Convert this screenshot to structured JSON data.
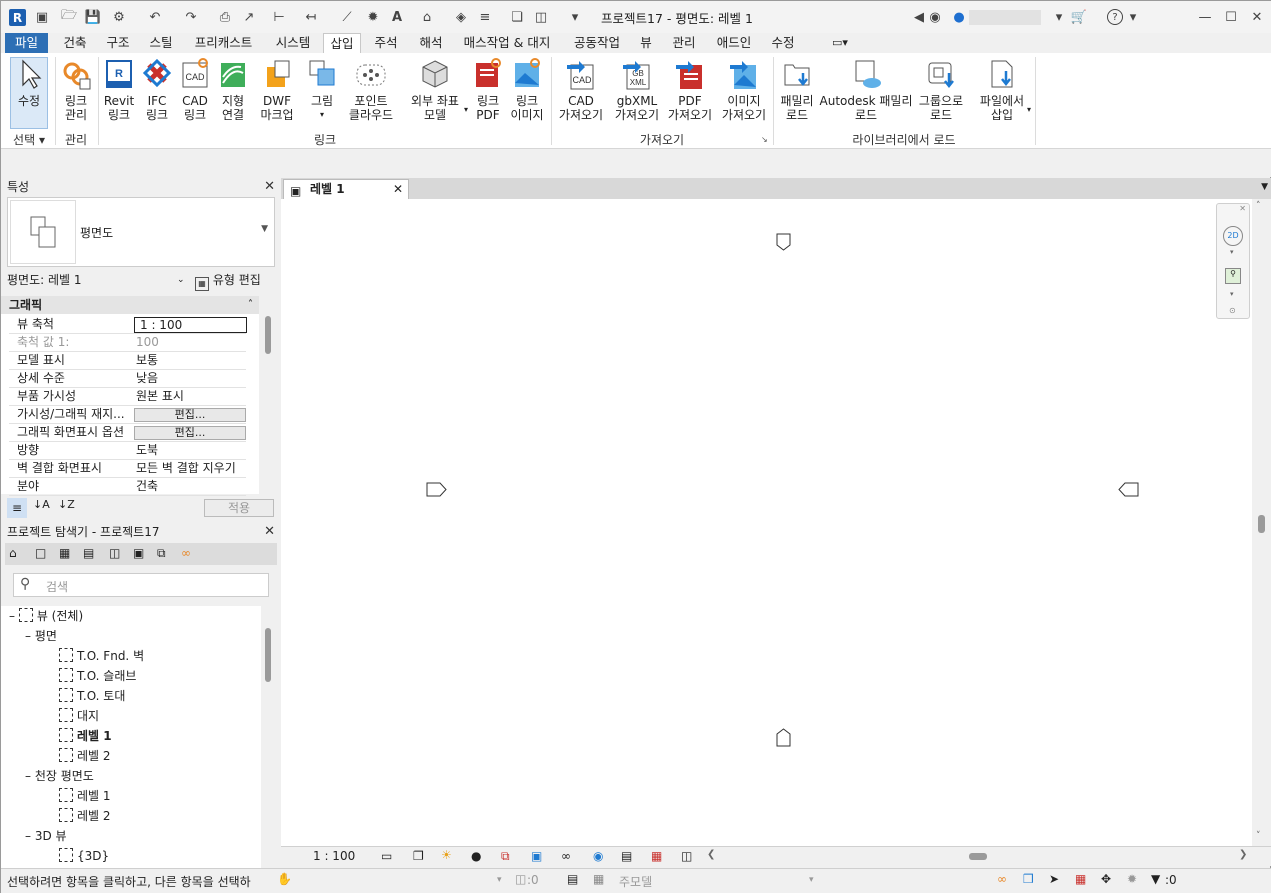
{
  "app": {
    "window_title": "프로젝트17 - 평면도: 레벨 1",
    "logo_letter": "R"
  },
  "colors": {
    "file_tab": "#2d6fb5",
    "accent_blue": "#1e7ad1",
    "accent_orange": "#e8892a",
    "accent_red": "#c9302c"
  },
  "menu": {
    "tabs": [
      "파일",
      "건축",
      "구조",
      "스틸",
      "프리캐스트",
      "시스템",
      "삽입",
      "주석",
      "해석",
      "매스작업 & 대지",
      "공동작업",
      "뷰",
      "관리",
      "애드인",
      "수정"
    ],
    "active_tab": "삽입"
  },
  "ribbon": {
    "modify": "수정",
    "select_group": "선택",
    "link_manage": "링크\n관리",
    "manage_group": "관리",
    "revit_link": "Revit\n링크",
    "ifc_link": "IFC\n링크",
    "cad_link": "CAD\n링크",
    "terrain_link": "지형\n연결",
    "dwf_markup": "DWF\n마크업",
    "image": "그림",
    "point_cloud": "포인트\n클라우드",
    "coord_model": "외부 좌표\n모델",
    "link_pdf": "링크\nPDF",
    "link_image": "링크\n이미지",
    "link_group": "링크",
    "cad_import": "CAD\n가져오기",
    "gbxml_import": "gbXML\n가져오기",
    "pdf_import": "PDF\n가져오기",
    "image_import": "이미지\n가져오기",
    "import_group": "가져오기",
    "family_load": "패밀리\n로드",
    "autodesk_family": "Autodesk 패밀리\n로드",
    "group_load": "그룹으로\n로드",
    "insert_from_file": "파일에서\n삽입",
    "library_group": "라이브러리에서 로드"
  },
  "properties": {
    "title": "특성",
    "type_name": "평면도",
    "instance_selector": "평면도: 레벨 1",
    "edit_type": "유형 편집",
    "section": "그래픽",
    "rows": [
      {
        "k": "뷰 축척",
        "v": "1 : 100"
      },
      {
        "k": "축척 값    1:",
        "v": "100"
      },
      {
        "k": "모델 표시",
        "v": "보통"
      },
      {
        "k": "상세 수준",
        "v": "낮음"
      },
      {
        "k": "부품 가시성",
        "v": "원본 표시"
      },
      {
        "k": "가시성/그래픽 재지...",
        "v": "편집..."
      },
      {
        "k": "그래픽 화면표시 옵션",
        "v": "편집..."
      },
      {
        "k": "방향",
        "v": "도북"
      },
      {
        "k": "벽 결합 화면표시",
        "v": "모든 벽 결합 지우기"
      },
      {
        "k": "분야",
        "v": "건축"
      }
    ],
    "apply": "적용"
  },
  "browser": {
    "title": "프로젝트 탐색기 - 프로젝트17",
    "search_placeholder": "검색",
    "root": "뷰 (전체)",
    "floor_plans": "평면",
    "plans": [
      "T.O. Fnd. 벽",
      "T.O. 슬래브",
      "T.O. 토대",
      "대지",
      "레벨 1",
      "레벨 2"
    ],
    "ceiling_plans": "천장 평면도",
    "ceilings": [
      "레벨 1",
      "레벨 2"
    ],
    "views_3d": "3D 뷰",
    "items_3d": [
      "{3D}"
    ]
  },
  "view": {
    "tab_label": "레벨 1",
    "scale": "1 : 100"
  },
  "status": {
    "message": "선택하려면 항목을 클릭하고, 다른 항목을 선택하",
    "workset_count": ":0",
    "model_label": "주모델",
    "filter_count": ":0"
  }
}
